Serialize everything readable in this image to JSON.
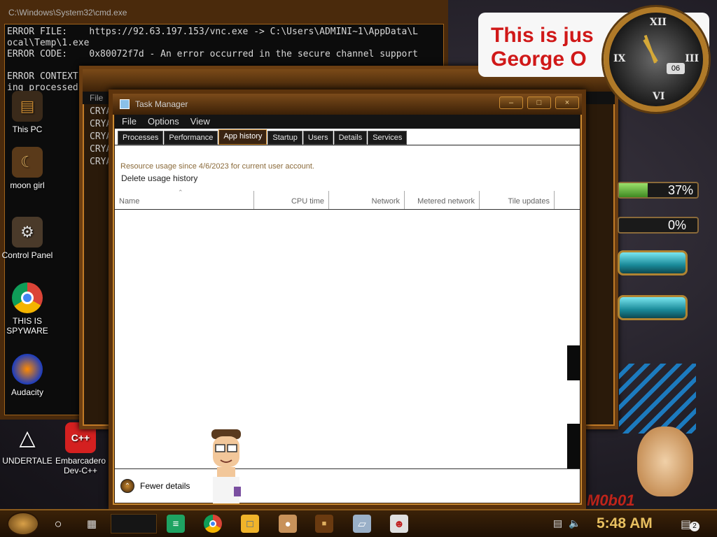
{
  "console": {
    "title": "C:\\Windows\\System32\\cmd.exe",
    "lines": [
      "ERROR FILE:    https://92.63.197.153/vnc.exe -> C:\\Users\\ADMINI~1\\AppData\\L",
      "ocal\\Temp\\1.exe",
      "ERROR CODE:    0x80072f7d - An error occurred in the secure channel support",
      "",
      "ERROR CONTEXT",
      "ing processed"
    ]
  },
  "bg_window": {
    "menu_label": "File",
    "lines": [
      "CRYA",
      "CRYA",
      "CRYA",
      "CRYA",
      "CRYA"
    ]
  },
  "desktop_icons": [
    {
      "label": "This PC",
      "icon": "computer-icon"
    },
    {
      "label": "moon girl",
      "icon": "image-icon"
    },
    {
      "label": "Control Panel",
      "icon": "control-panel-icon"
    },
    {
      "label": "THIS IS SPYWARE",
      "icon": "chrome-icon"
    },
    {
      "label": "Audacity",
      "icon": "audacity-icon"
    },
    {
      "label": "UNDERTALE",
      "icon": "unity-icon"
    },
    {
      "label": "Embarcadero Dev-C++",
      "icon": "devcpp-icon"
    }
  ],
  "task_manager": {
    "title": "Task Manager",
    "menu": [
      "File",
      "Options",
      "View"
    ],
    "tabs": [
      "Processes",
      "Performance",
      "App history",
      "Startup",
      "Users",
      "Details",
      "Services"
    ],
    "active_tab": "App history",
    "usage_since": "Resource usage since 4/6/2023 for current user account.",
    "delete_history": "Delete usage history",
    "columns": [
      "Name",
      "CPU time",
      "Network",
      "Metered network",
      "Tile updates"
    ],
    "rows": [],
    "footer_label": "Fewer details"
  },
  "gadgets": {
    "banner_text": "This is just ... George O...",
    "banner_line1": "This is jus",
    "banner_line2": "George O",
    "clock_date": "06",
    "clock_numerals": [
      "XII",
      "III",
      "VI",
      "IX"
    ],
    "cpu_meter": {
      "value": "37%",
      "fraction": 0.37
    },
    "ram_meter": {
      "value": "0%",
      "fraction": 0.0
    },
    "watermark": "M0b01"
  },
  "taskbar": {
    "time": "5:48 AM",
    "notification_count": "2",
    "pinned": [
      {
        "name": "google-sheets-icon"
      },
      {
        "name": "chrome-icon"
      },
      {
        "name": "file-explorer-icon"
      },
      {
        "name": "hamster-app-icon"
      },
      {
        "name": "app-icon"
      },
      {
        "name": "folder-icon"
      },
      {
        "name": "theater-masks-icon"
      }
    ],
    "colors": {
      "accent": "#c98a32",
      "clock_text": "#e8c060"
    }
  }
}
